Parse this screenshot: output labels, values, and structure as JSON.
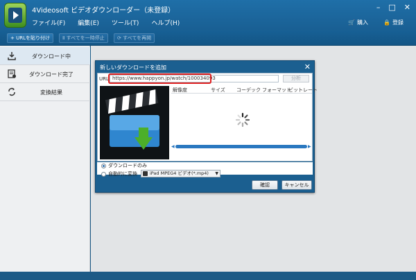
{
  "app": {
    "title": "4Videosoft ビデオダウンローダー（未登録）"
  },
  "window_controls": {
    "minimize": "–",
    "restore": "□",
    "close": "✕"
  },
  "menu": [
    {
      "label": "ファイル(F)"
    },
    {
      "label": "編集(E)"
    },
    {
      "label": "ツール(T)"
    },
    {
      "label": "ヘルプ(H)"
    }
  ],
  "top_right": {
    "purchase": "購入",
    "register": "登録"
  },
  "toolbar": {
    "paste_url": "+ URLを貼り付け",
    "pause_all": "Ⅱ すべてを一時停止",
    "resume_all": "⟳ すべてを再開"
  },
  "sidebar": {
    "items": [
      {
        "label": "ダウンロード中",
        "icon": "download-icon"
      },
      {
        "label": "ダウンロード完了",
        "icon": "completed-icon"
      },
      {
        "label": "変換結果",
        "icon": "convert-icon"
      }
    ]
  },
  "dialog": {
    "title": "新しいダウンロードを追加",
    "close": "✕",
    "url_label": "URL:",
    "url_value": "https://www.happyon.jp/watch/100034093",
    "analyze_label": "分析",
    "columns": [
      "解像度",
      "サイズ",
      "コーデック",
      "フォーマット",
      "ビットレート"
    ],
    "option_download_only": "ダウンロードのみ",
    "option_auto_convert": "自動的に変換",
    "format_value": "iPad MPEG4 ビデオ(*.mp4)",
    "ok_label": "確認",
    "cancel_label": "キャンセル"
  },
  "colors": {
    "accent": "#1b5f90",
    "highlight": "#e02020",
    "toolbar": "#176095"
  }
}
